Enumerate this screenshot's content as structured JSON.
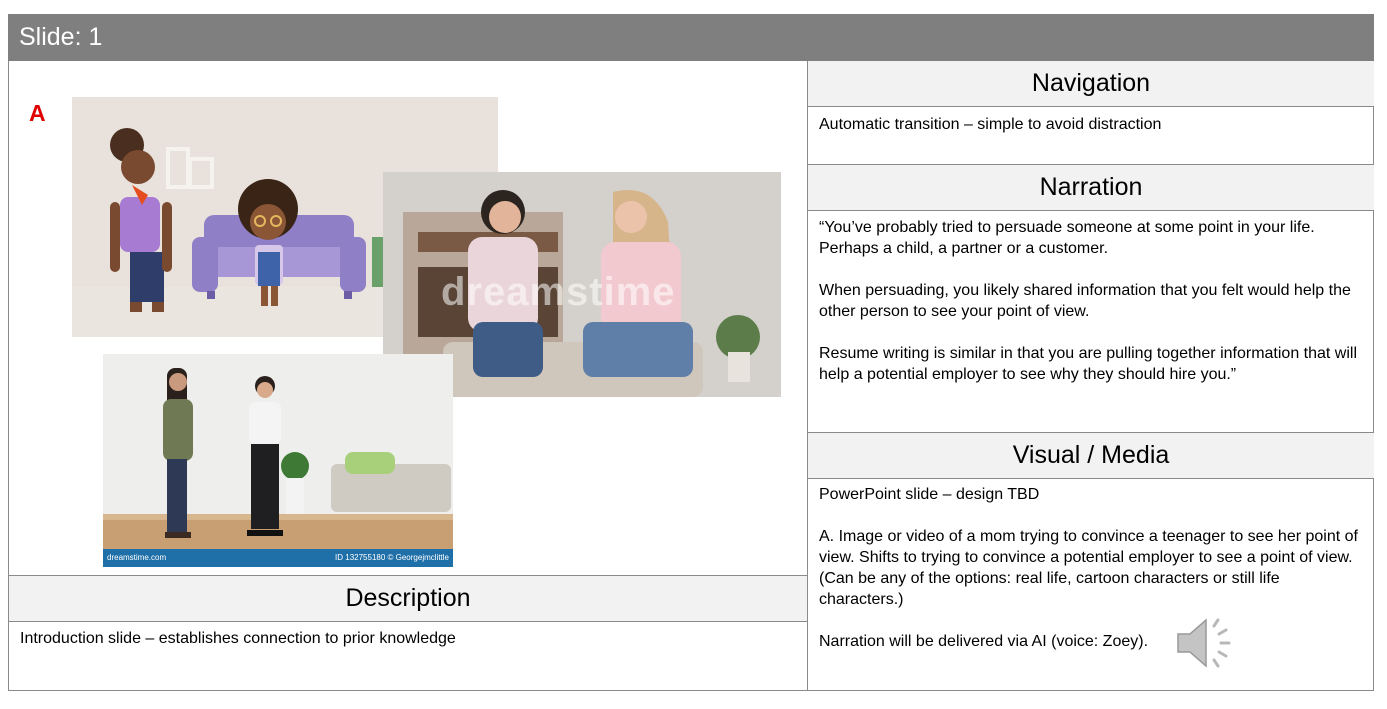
{
  "header": {
    "title": "Slide: 1"
  },
  "left": {
    "label_a": "A",
    "images": {
      "cartoon": "cartoon-characters-image",
      "photo_sofa": "two-women-talking-on-sofa-photo",
      "photo_standing": "two-women-standing-photo"
    },
    "watermarks": {
      "sofa": "dreamstime",
      "strip_left": "dreamstime.com",
      "strip_right": "ID 132755180 © Georgejmclittle"
    }
  },
  "description": {
    "heading": "Description",
    "text": "Introduction slide – establishes connection to prior knowledge"
  },
  "navigation": {
    "heading": "Navigation",
    "text": "Automatic transition – simple to avoid distraction"
  },
  "narration": {
    "heading": "Narration",
    "paragraphs": [
      "“You’ve probably tried to persuade someone at some point in your life. Perhaps a child, a partner or a customer.",
      "When persuading, you likely shared information that you felt would help the other person to see your point of view.",
      "Resume writing is similar in that you are pulling together information that will help a potential employer to see why they should hire you.”"
    ]
  },
  "visual_media": {
    "heading": "Visual / Media",
    "paragraphs": [
      "PowerPoint slide – design TBD",
      "A. Image or video of a mom trying to convince a teenager to see her point of view. Shifts to trying to convince a potential employer to see a point of view. (Can be any of the options: real life, cartoon characters or still life characters.)",
      "Narration will be delivered via AI (voice: Zoey)."
    ],
    "audio_icon": "speaker-icon"
  }
}
